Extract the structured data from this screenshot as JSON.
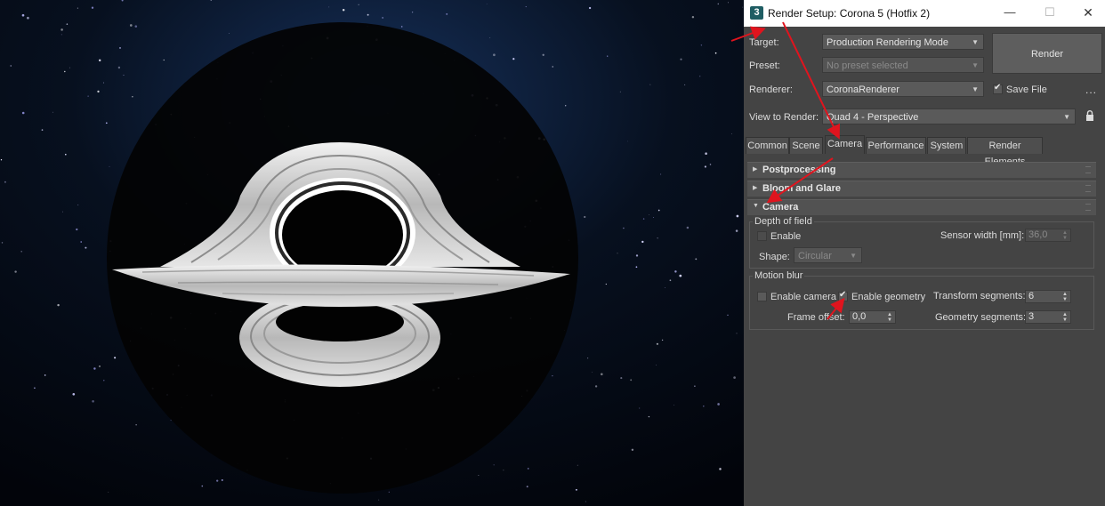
{
  "window": {
    "title": "Render Setup: Corona 5 (Hotfix 2)",
    "app_icon_label": "3",
    "minimize_glyph": "—",
    "maximize_glyph": "☐",
    "close_glyph": "✕"
  },
  "header": {
    "target_label": "Target:",
    "target_value": "Production Rendering Mode",
    "preset_label": "Preset:",
    "preset_value": "No preset selected",
    "renderer_label": "Renderer:",
    "renderer_value": "CoronaRenderer",
    "save_file_label": "Save File",
    "save_file_checked": true,
    "view_label": "View to Render:",
    "view_value": "Quad 4 - Perspective",
    "render_button": "Render",
    "more_label": "..."
  },
  "tabs": [
    {
      "label": "Common"
    },
    {
      "label": "Scene"
    },
    {
      "label": "Camera",
      "active": true
    },
    {
      "label": "Performance"
    },
    {
      "label": "System"
    },
    {
      "label": "Render Elements"
    }
  ],
  "rollouts": {
    "postprocessing": "Postprocessing",
    "bloom": "Bloom and Glare",
    "camera": "Camera"
  },
  "dof": {
    "group_label": "Depth of field",
    "enable_label": "Enable",
    "sensor_label": "Sensor width [mm]:",
    "sensor_value": "36,0",
    "shape_label": "Shape:",
    "shape_value": "Circular"
  },
  "motion_blur": {
    "group_label": "Motion blur",
    "enable_camera_label": "Enable camera",
    "enable_geometry_label": "Enable geometry",
    "enable_geometry_checked": true,
    "transform_label": "Transform segments:",
    "transform_value": "6",
    "frame_offset_label": "Frame offset:",
    "frame_offset_value": "0,0",
    "geometry_label": "Geometry segments:",
    "geometry_value": "3"
  },
  "colors": {
    "panel_bg": "#444444",
    "annotation_arrow": "#e0141e",
    "disk": "#d9d9d9"
  }
}
